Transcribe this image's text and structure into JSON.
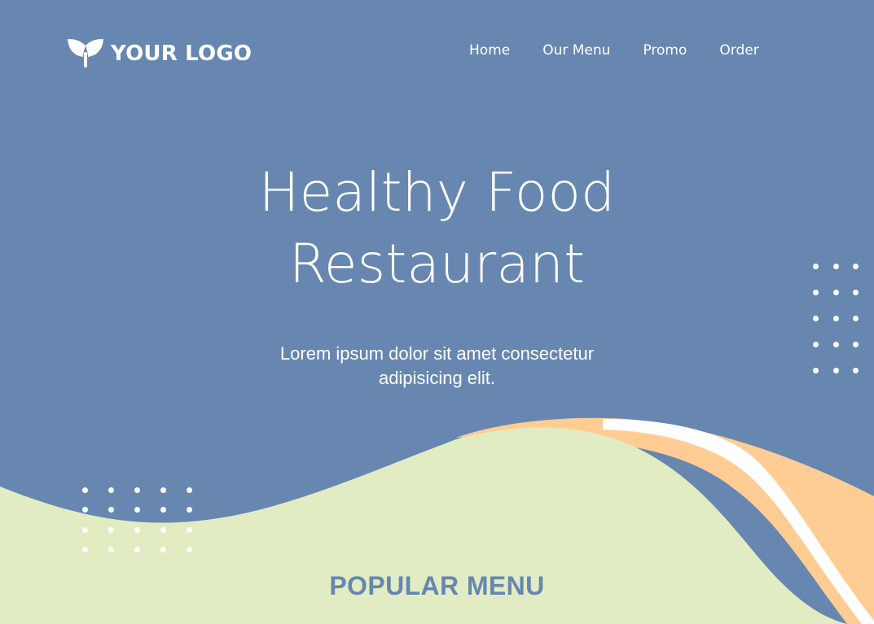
{
  "brand": {
    "logo_text": "YOUR LOGO"
  },
  "nav": {
    "items": [
      "Home",
      "Our Menu",
      "Promo",
      "Order"
    ]
  },
  "hero": {
    "title_line1": "Healthy Food",
    "title_line2": "Restaurant",
    "subtitle_line1": "Lorem ipsum dolor sit amet consectetur",
    "subtitle_line2": "adipisicing elit."
  },
  "section": {
    "popular_title": "POPULAR MENU"
  },
  "theme": {
    "background": "#6787b1",
    "text": "#ffffff",
    "wave_green": "#e1ecc2",
    "wave_orange": "#ffcd93",
    "accent": "#6787b1"
  },
  "icons": {
    "logo": "leaf-icon"
  }
}
